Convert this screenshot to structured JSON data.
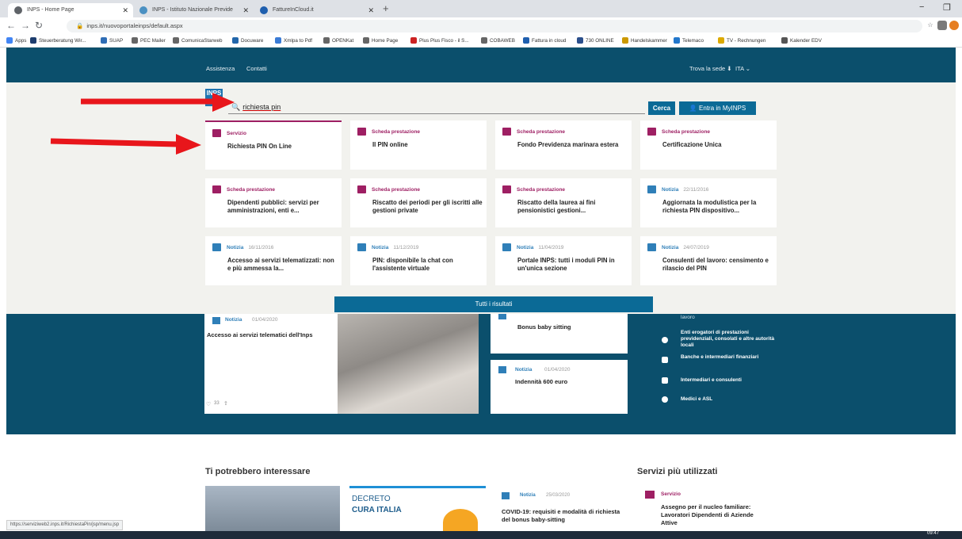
{
  "browser": {
    "tabs": [
      {
        "title": "INPS - Home Page",
        "icon_color": "#5f6368",
        "active": true
      },
      {
        "title": "INPS - Istituto Nazionale Previde",
        "icon_color": "#4a90c2",
        "active": false
      },
      {
        "title": "FattureInCloud.it",
        "icon_color": "#1f5fae",
        "active": false
      }
    ],
    "new_tab": "+",
    "url": "inps.it/nuovoportaleinps/default.aspx",
    "window_controls": {
      "minimize": "−",
      "restore": "❐"
    },
    "bookmarks": [
      {
        "label": "Apps",
        "color": "#4285f4"
      },
      {
        "label": "Steuerberatung Wir...",
        "color": "#1d3d6e"
      },
      {
        "label": "SUAP",
        "color": "#2f6db5"
      },
      {
        "label": "PEC Mailer",
        "color": "#666666"
      },
      {
        "label": "ComunicaStarweb",
        "color": "#666666"
      },
      {
        "label": "Docuware",
        "color": "#2266aa"
      },
      {
        "label": "Xmlpa to Pdf",
        "color": "#3a7bd5"
      },
      {
        "label": "OPENKat",
        "color": "#666666"
      },
      {
        "label": "Home Page",
        "color": "#666666"
      },
      {
        "label": "Plus Plus Fisco - il S...",
        "color": "#cc2222"
      },
      {
        "label": "COBAWEB",
        "color": "#666666"
      },
      {
        "label": "Fattura in cloud",
        "color": "#1f5fae"
      },
      {
        "label": "730 ONLINE",
        "color": "#2b4f8c"
      },
      {
        "label": "Handelskammer",
        "color": "#cc9900"
      },
      {
        "label": "Telemaco",
        "color": "#2277cc"
      },
      {
        "label": "TV - Rechnungen",
        "color": "#ddaa00"
      },
      {
        "label": "Kalender EDV",
        "color": "#555555"
      }
    ],
    "status_url": "https://serviziweb2.inps.it/RichiestaPin/jsp/menu.jsp"
  },
  "inps_bar": {
    "assistenza": "Assistenza",
    "contatti": "Contatti",
    "trova_sede": "Trova la sede",
    "lang": "ITA"
  },
  "logo_text": "INPS",
  "search": {
    "query": "richiesta pin",
    "cerca": "Cerca",
    "entra": "Entra in MyINPS"
  },
  "results": [
    {
      "type": "Servizio",
      "date": "",
      "title": "Richiesta PIN On Line",
      "kind": "servizio"
    },
    {
      "type": "Scheda prestazione",
      "date": "",
      "title": "Il PIN online",
      "kind": "scheda"
    },
    {
      "type": "Scheda prestazione",
      "date": "",
      "title": "Fondo Previdenza marinara estera",
      "kind": "scheda"
    },
    {
      "type": "Scheda prestazione",
      "date": "",
      "title": "Certificazione Unica",
      "kind": "scheda"
    },
    {
      "type": "Scheda prestazione",
      "date": "",
      "title": "Dipendenti pubblici: servizi per amministrazioni, enti e...",
      "kind": "scheda"
    },
    {
      "type": "Scheda prestazione",
      "date": "",
      "title": "Riscatto dei periodi per gli iscritti alle gestioni private",
      "kind": "scheda"
    },
    {
      "type": "Scheda prestazione",
      "date": "",
      "title": "Riscatto della laurea ai fini pensionistici gestioni...",
      "kind": "scheda"
    },
    {
      "type": "Notizia",
      "date": "22/11/2016",
      "title": "Aggiornata la modulistica per la richiesta PIN dispositivo...",
      "kind": "notizia"
    },
    {
      "type": "Notizia",
      "date": "16/11/2016",
      "title": "Accesso ai servizi telematizzati: non e più ammessa la...",
      "kind": "notizia"
    },
    {
      "type": "Notizia",
      "date": "11/12/2019",
      "title": "PIN: disponibile la chat con l'assistente virtuale",
      "kind": "notizia"
    },
    {
      "type": "Notizia",
      "date": "11/04/2019",
      "title": "Portale INPS: tutti i moduli PIN in un'unica sezione",
      "kind": "notizia"
    },
    {
      "type": "Notizia",
      "date": "24/07/2019",
      "title": "Consulenti del lavoro: censimento e rilascio del PIN",
      "kind": "notizia"
    }
  ],
  "all_results": "Tutti i risultati",
  "colors": {
    "servizio": "#9e1f63",
    "scheda": "#9e1f63",
    "notizia": "#2f7fb8",
    "brand": "#0b4f6c",
    "button": "#0b6a96"
  },
  "below": {
    "main_card": {
      "type": "Notizia",
      "date": "01/04/2020",
      "title": "Accesso ai servizi telematici dell'Inps",
      "likes": "33"
    },
    "card_bonus": {
      "title": "Bonus baby sitting"
    },
    "card_indennita": {
      "type": "Notizia",
      "date": "01/04/2020",
      "title": "Indennità 600 euro"
    },
    "side_items": [
      "lavoro",
      "Enti erogatori di prestazioni previdenziali, consolati e altre autorità locali",
      "Banche e intermediari finanziari",
      "Intermediari e consulenti",
      "Medici e ASL"
    ],
    "section_left": "Ti potrebbero interessare",
    "section_right": "Servizi più utilizzati",
    "decreto_line1": "DECRETO",
    "decreto_line2": "CURA ITALIA",
    "covid": {
      "type": "Notizia",
      "date": "25/03/2020",
      "title": "COVID-19: requisiti e modalità di richiesta del bonus baby-sitting"
    },
    "servizio": {
      "type": "Servizio",
      "title": "Assegno per il nucleo familiare: Lavoratori Dipendenti di Aziende Attive"
    }
  },
  "clock": "09:47"
}
